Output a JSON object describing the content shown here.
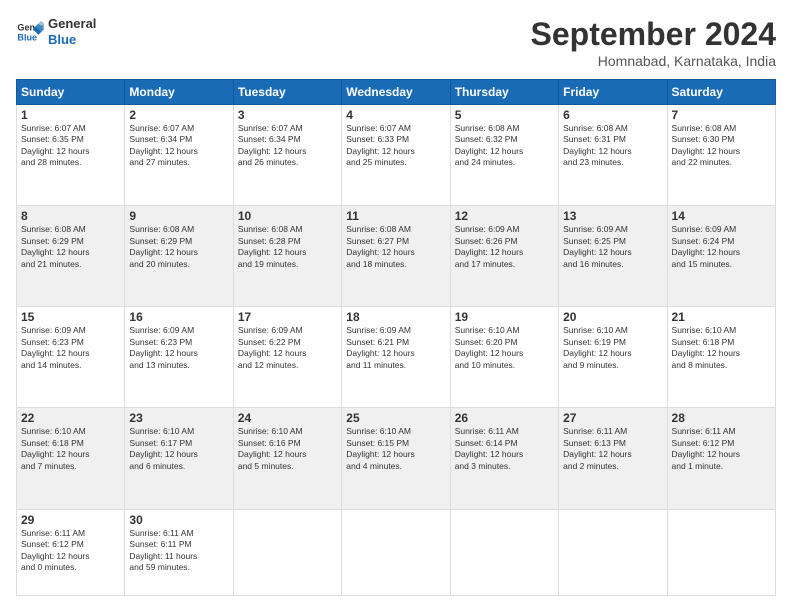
{
  "logo": {
    "line1": "General",
    "line2": "Blue"
  },
  "title": "September 2024",
  "location": "Homnabad, Karnataka, India",
  "days_of_week": [
    "Sunday",
    "Monday",
    "Tuesday",
    "Wednesday",
    "Thursday",
    "Friday",
    "Saturday"
  ],
  "weeks": [
    [
      {
        "day": "1",
        "lines": [
          "Sunrise: 6:07 AM",
          "Sunset: 6:35 PM",
          "Daylight: 12 hours",
          "and 28 minutes."
        ]
      },
      {
        "day": "2",
        "lines": [
          "Sunrise: 6:07 AM",
          "Sunset: 6:34 PM",
          "Daylight: 12 hours",
          "and 27 minutes."
        ]
      },
      {
        "day": "3",
        "lines": [
          "Sunrise: 6:07 AM",
          "Sunset: 6:34 PM",
          "Daylight: 12 hours",
          "and 26 minutes."
        ]
      },
      {
        "day": "4",
        "lines": [
          "Sunrise: 6:07 AM",
          "Sunset: 6:33 PM",
          "Daylight: 12 hours",
          "and 25 minutes."
        ]
      },
      {
        "day": "5",
        "lines": [
          "Sunrise: 6:08 AM",
          "Sunset: 6:32 PM",
          "Daylight: 12 hours",
          "and 24 minutes."
        ]
      },
      {
        "day": "6",
        "lines": [
          "Sunrise: 6:08 AM",
          "Sunset: 6:31 PM",
          "Daylight: 12 hours",
          "and 23 minutes."
        ]
      },
      {
        "day": "7",
        "lines": [
          "Sunrise: 6:08 AM",
          "Sunset: 6:30 PM",
          "Daylight: 12 hours",
          "and 22 minutes."
        ]
      }
    ],
    [
      {
        "day": "8",
        "lines": [
          "Sunrise: 6:08 AM",
          "Sunset: 6:29 PM",
          "Daylight: 12 hours",
          "and 21 minutes."
        ]
      },
      {
        "day": "9",
        "lines": [
          "Sunrise: 6:08 AM",
          "Sunset: 6:29 PM",
          "Daylight: 12 hours",
          "and 20 minutes."
        ]
      },
      {
        "day": "10",
        "lines": [
          "Sunrise: 6:08 AM",
          "Sunset: 6:28 PM",
          "Daylight: 12 hours",
          "and 19 minutes."
        ]
      },
      {
        "day": "11",
        "lines": [
          "Sunrise: 6:08 AM",
          "Sunset: 6:27 PM",
          "Daylight: 12 hours",
          "and 18 minutes."
        ]
      },
      {
        "day": "12",
        "lines": [
          "Sunrise: 6:09 AM",
          "Sunset: 6:26 PM",
          "Daylight: 12 hours",
          "and 17 minutes."
        ]
      },
      {
        "day": "13",
        "lines": [
          "Sunrise: 6:09 AM",
          "Sunset: 6:25 PM",
          "Daylight: 12 hours",
          "and 16 minutes."
        ]
      },
      {
        "day": "14",
        "lines": [
          "Sunrise: 6:09 AM",
          "Sunset: 6:24 PM",
          "Daylight: 12 hours",
          "and 15 minutes."
        ]
      }
    ],
    [
      {
        "day": "15",
        "lines": [
          "Sunrise: 6:09 AM",
          "Sunset: 6:23 PM",
          "Daylight: 12 hours",
          "and 14 minutes."
        ]
      },
      {
        "day": "16",
        "lines": [
          "Sunrise: 6:09 AM",
          "Sunset: 6:23 PM",
          "Daylight: 12 hours",
          "and 13 minutes."
        ]
      },
      {
        "day": "17",
        "lines": [
          "Sunrise: 6:09 AM",
          "Sunset: 6:22 PM",
          "Daylight: 12 hours",
          "and 12 minutes."
        ]
      },
      {
        "day": "18",
        "lines": [
          "Sunrise: 6:09 AM",
          "Sunset: 6:21 PM",
          "Daylight: 12 hours",
          "and 11 minutes."
        ]
      },
      {
        "day": "19",
        "lines": [
          "Sunrise: 6:10 AM",
          "Sunset: 6:20 PM",
          "Daylight: 12 hours",
          "and 10 minutes."
        ]
      },
      {
        "day": "20",
        "lines": [
          "Sunrise: 6:10 AM",
          "Sunset: 6:19 PM",
          "Daylight: 12 hours",
          "and 9 minutes."
        ]
      },
      {
        "day": "21",
        "lines": [
          "Sunrise: 6:10 AM",
          "Sunset: 6:18 PM",
          "Daylight: 12 hours",
          "and 8 minutes."
        ]
      }
    ],
    [
      {
        "day": "22",
        "lines": [
          "Sunrise: 6:10 AM",
          "Sunset: 6:18 PM",
          "Daylight: 12 hours",
          "and 7 minutes."
        ]
      },
      {
        "day": "23",
        "lines": [
          "Sunrise: 6:10 AM",
          "Sunset: 6:17 PM",
          "Daylight: 12 hours",
          "and 6 minutes."
        ]
      },
      {
        "day": "24",
        "lines": [
          "Sunrise: 6:10 AM",
          "Sunset: 6:16 PM",
          "Daylight: 12 hours",
          "and 5 minutes."
        ]
      },
      {
        "day": "25",
        "lines": [
          "Sunrise: 6:10 AM",
          "Sunset: 6:15 PM",
          "Daylight: 12 hours",
          "and 4 minutes."
        ]
      },
      {
        "day": "26",
        "lines": [
          "Sunrise: 6:11 AM",
          "Sunset: 6:14 PM",
          "Daylight: 12 hours",
          "and 3 minutes."
        ]
      },
      {
        "day": "27",
        "lines": [
          "Sunrise: 6:11 AM",
          "Sunset: 6:13 PM",
          "Daylight: 12 hours",
          "and 2 minutes."
        ]
      },
      {
        "day": "28",
        "lines": [
          "Sunrise: 6:11 AM",
          "Sunset: 6:12 PM",
          "Daylight: 12 hours",
          "and 1 minute."
        ]
      }
    ],
    [
      {
        "day": "29",
        "lines": [
          "Sunrise: 6:11 AM",
          "Sunset: 6:12 PM",
          "Daylight: 12 hours",
          "and 0 minutes."
        ]
      },
      {
        "day": "30",
        "lines": [
          "Sunrise: 6:11 AM",
          "Sunset: 6:11 PM",
          "Daylight: 11 hours",
          "and 59 minutes."
        ]
      },
      null,
      null,
      null,
      null,
      null
    ]
  ]
}
